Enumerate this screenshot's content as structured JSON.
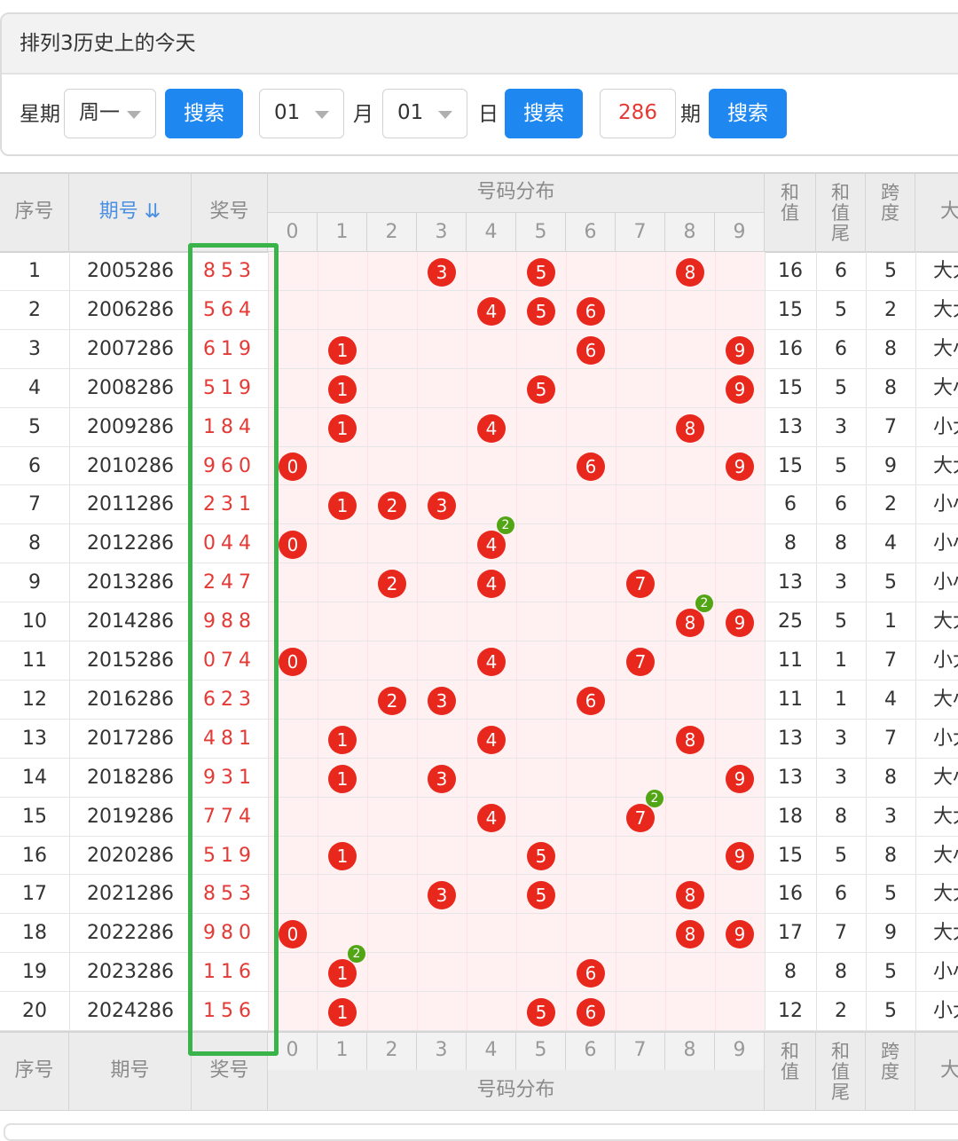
{
  "panel": {
    "title": "排列3历史上的今天",
    "weekday_label": "星期",
    "weekday_value": "周一",
    "search_label": "搜索",
    "month_value": "01",
    "month_label": "月",
    "day_value": "01",
    "day_label": "日",
    "period_value": "286",
    "period_label": "期"
  },
  "table": {
    "headers": {
      "seq": "序号",
      "issue": "期号",
      "sort_icon": "⇊",
      "prize": "奖号",
      "dist": "号码分布",
      "sum": "和值",
      "sum_tail": "和值尾",
      "span": "跨度",
      "size": "大"
    },
    "digits": [
      "0",
      "1",
      "2",
      "3",
      "4",
      "5",
      "6",
      "7",
      "8",
      "9"
    ],
    "rows": [
      {
        "seq": "1",
        "issue": "2005286",
        "prize": "853",
        "sum": "16",
        "tail": "6",
        "span": "5",
        "size": "大大"
      },
      {
        "seq": "2",
        "issue": "2006286",
        "prize": "564",
        "sum": "15",
        "tail": "5",
        "span": "2",
        "size": "大大"
      },
      {
        "seq": "3",
        "issue": "2007286",
        "prize": "619",
        "sum": "16",
        "tail": "6",
        "span": "8",
        "size": "大小"
      },
      {
        "seq": "4",
        "issue": "2008286",
        "prize": "519",
        "sum": "15",
        "tail": "5",
        "span": "8",
        "size": "大小"
      },
      {
        "seq": "5",
        "issue": "2009286",
        "prize": "184",
        "sum": "13",
        "tail": "3",
        "span": "7",
        "size": "小大"
      },
      {
        "seq": "6",
        "issue": "2010286",
        "prize": "960",
        "sum": "15",
        "tail": "5",
        "span": "9",
        "size": "大大"
      },
      {
        "seq": "7",
        "issue": "2011286",
        "prize": "231",
        "sum": "6",
        "tail": "6",
        "span": "2",
        "size": "小小"
      },
      {
        "seq": "8",
        "issue": "2012286",
        "prize": "044",
        "sum": "8",
        "tail": "8",
        "span": "4",
        "size": "小小"
      },
      {
        "seq": "9",
        "issue": "2013286",
        "prize": "247",
        "sum": "13",
        "tail": "3",
        "span": "5",
        "size": "小小"
      },
      {
        "seq": "10",
        "issue": "2014286",
        "prize": "988",
        "sum": "25",
        "tail": "5",
        "span": "1",
        "size": "大大"
      },
      {
        "seq": "11",
        "issue": "2015286",
        "prize": "074",
        "sum": "11",
        "tail": "1",
        "span": "7",
        "size": "小大"
      },
      {
        "seq": "12",
        "issue": "2016286",
        "prize": "623",
        "sum": "11",
        "tail": "1",
        "span": "4",
        "size": "大小"
      },
      {
        "seq": "13",
        "issue": "2017286",
        "prize": "481",
        "sum": "13",
        "tail": "3",
        "span": "7",
        "size": "小大"
      },
      {
        "seq": "14",
        "issue": "2018286",
        "prize": "931",
        "sum": "13",
        "tail": "3",
        "span": "8",
        "size": "大小"
      },
      {
        "seq": "15",
        "issue": "2019286",
        "prize": "774",
        "sum": "18",
        "tail": "8",
        "span": "3",
        "size": "大大"
      },
      {
        "seq": "16",
        "issue": "2020286",
        "prize": "519",
        "sum": "15",
        "tail": "5",
        "span": "8",
        "size": "大小"
      },
      {
        "seq": "17",
        "issue": "2021286",
        "prize": "853",
        "sum": "16",
        "tail": "6",
        "span": "5",
        "size": "大大"
      },
      {
        "seq": "18",
        "issue": "2022286",
        "prize": "980",
        "sum": "17",
        "tail": "7",
        "span": "9",
        "size": "大大"
      },
      {
        "seq": "19",
        "issue": "2023286",
        "prize": "116",
        "sum": "8",
        "tail": "8",
        "span": "5",
        "size": "小小"
      },
      {
        "seq": "20",
        "issue": "2024286",
        "prize": "156",
        "sum": "12",
        "tail": "2",
        "span": "5",
        "size": "小大"
      }
    ]
  },
  "colors": {
    "ball": "#e8271d",
    "repeat_badge": "#52a515",
    "button": "#1e88f0",
    "highlight_box": "#3ab44a"
  }
}
